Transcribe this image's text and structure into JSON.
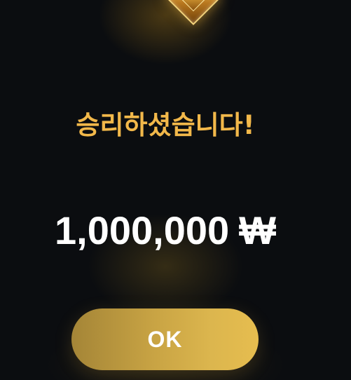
{
  "result_dialog": {
    "title": "승리하셨습니다!",
    "amount": "1,000,000",
    "currency_symbol": "₩",
    "ok_label": "OK"
  },
  "colors": {
    "background": "#0b0d10",
    "title": "#f2b84a",
    "amount": "#ffffff",
    "button_gold": "#dcb64e"
  },
  "icons": {
    "top_emblem": "gold-gem-icon"
  }
}
